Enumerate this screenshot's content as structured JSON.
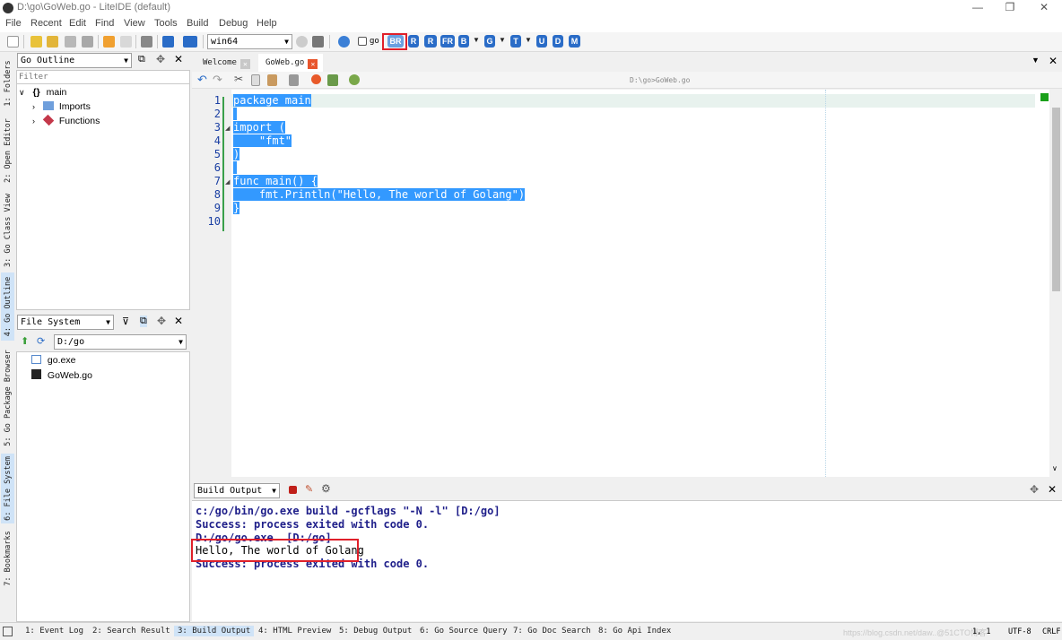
{
  "window": {
    "title": "D:\\go\\GoWeb.go - LiteIDE (default)",
    "minimize": "—",
    "restore": "❐",
    "close": "✕"
  },
  "menu": [
    "File",
    "Recent",
    "Edit",
    "Find",
    "View",
    "Tools",
    "Build",
    "Debug",
    "Help"
  ],
  "toolbar": {
    "env_select": "win64",
    "go_checkbox_label": "go",
    "build_buttons": [
      "BR",
      "R",
      "R",
      "FR",
      "B",
      "G",
      "T",
      "U",
      "D",
      "M"
    ]
  },
  "left_tabs": [
    "1: Folders",
    "2: Open Editor",
    "3: Go Class View",
    "4: Go Outline",
    "5: Go Package Browser",
    "6: File System",
    "7: Bookmarks"
  ],
  "outline": {
    "select": "Go Outline",
    "filter_placeholder": "Filter",
    "root": "main",
    "root_glyph": "{}",
    "children": [
      "Imports",
      "Functions"
    ]
  },
  "filesystem": {
    "select": "File System",
    "path": "D:/go",
    "files": [
      "go.exe",
      "GoWeb.go"
    ]
  },
  "editor": {
    "tabs": [
      "Welcome",
      "GoWeb.go"
    ],
    "active_tab": "GoWeb.go",
    "path": "D:\\go>GoWeb.go",
    "line_numbers": [
      "1",
      "2",
      "3",
      "4",
      "5",
      "6",
      "7",
      "8",
      "9",
      "10"
    ],
    "lines": [
      "package main",
      "",
      "import (",
      "    \"fmt\"",
      ")",
      "",
      "func main() {",
      "    fmt.Println(\"Hello, The world of Golang\")",
      "}",
      ""
    ],
    "selection_color": "#3399ff"
  },
  "output": {
    "select": "Build Output",
    "lines": [
      {
        "text": "c:/go/bin/go.exe build -gcflags \"-N -l\" [D:/go]",
        "color": "#1f1f8a",
        "bold": true
      },
      {
        "text": "Success: process exited with code 0.",
        "color": "#1f1f8a",
        "bold": true
      },
      {
        "text": "D:/go/go.exe  [D:/go]",
        "color": "#1f1f8a",
        "bold": true
      },
      {
        "text": "Hello, The world of Golang",
        "color": "#000000",
        "bold": false
      },
      {
        "text": "Success: process exited with code 0.",
        "color": "#1f1f8a",
        "bold": true
      }
    ]
  },
  "statusbar": {
    "tabs": [
      "1: Event Log",
      "2: Search Result",
      "3: Build Output",
      "4: HTML Preview",
      "5: Debug Output",
      "6: Go Source Query",
      "7: Go Doc Search",
      "8: Go Api Index"
    ],
    "active_tab": "3: Build Output",
    "position": "1,  1",
    "encoding": "UTF-8",
    "line_ending": "CRLF",
    "watermark": "https://blog.csdn.net/daw..@51CTO博客"
  },
  "colors": {
    "accent": "#2a6cc7",
    "highlight_box": "#e0202a"
  }
}
